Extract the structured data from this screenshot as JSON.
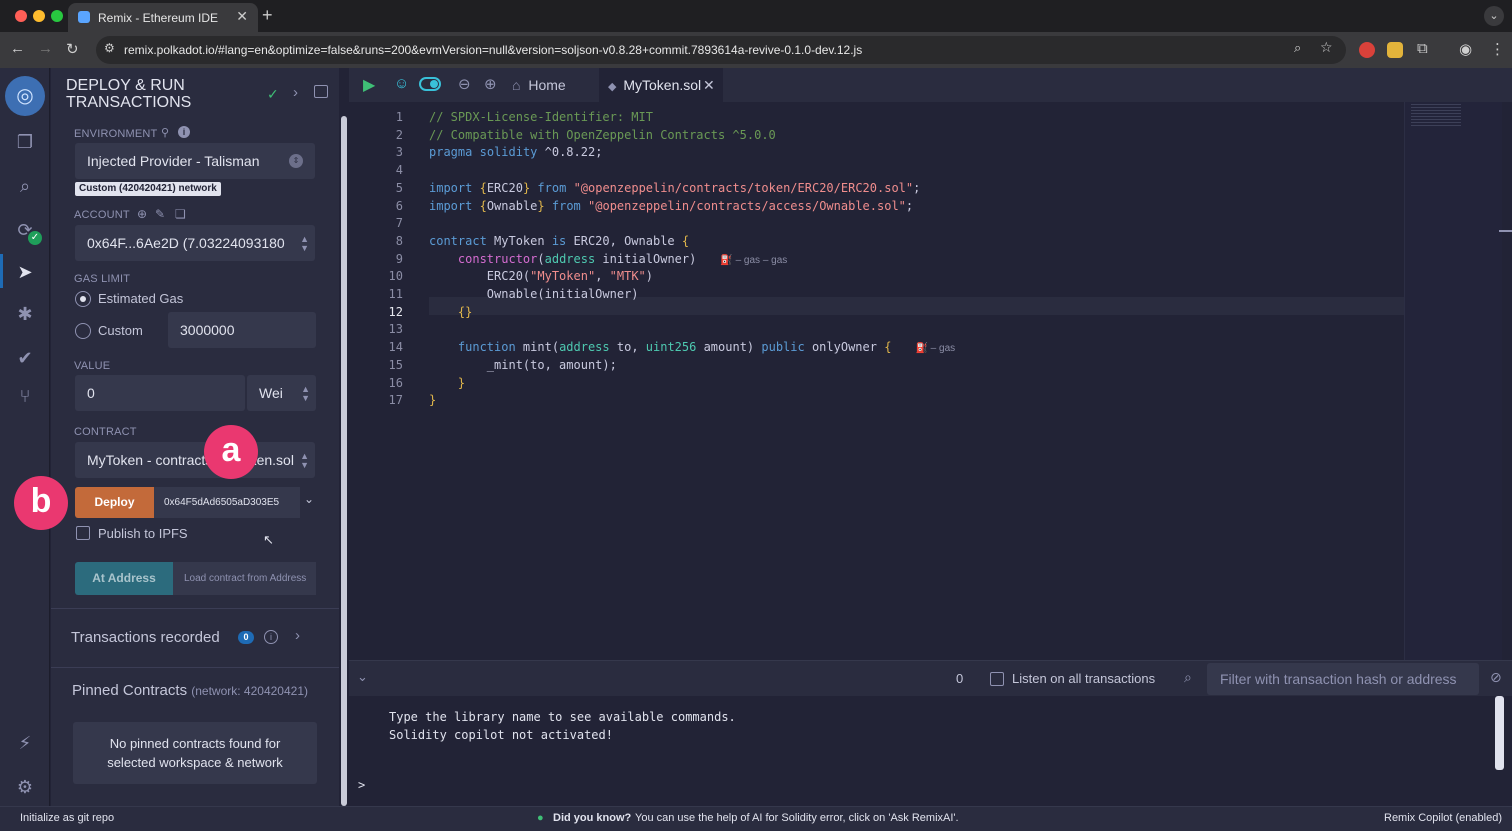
{
  "browser": {
    "tab_title": "Remix - Ethereum IDE",
    "url": "remix.polkadot.io/#lang=en&optimize=false&runs=200&evmVersion=null&version=soljson-v0.8.28+commit.7893614a-revive-0.1.0-dev.12.js"
  },
  "sidepanel": {
    "title_line1": "DEPLOY & RUN",
    "title_line2": "TRANSACTIONS",
    "environment_label": "ENVIRONMENT",
    "environment_value": "Injected Provider - Talisman",
    "network_badge": "Custom (420420421) network",
    "account_label": "ACCOUNT",
    "account_value": "0x64F...6Ae2D (7.03224093180",
    "gas_limit_label": "GAS LIMIT",
    "gas_estimated": "Estimated Gas",
    "gas_custom": "Custom",
    "gas_custom_value": "3000000",
    "value_label": "VALUE",
    "value_amount": "0",
    "value_unit": "Wei",
    "contract_label": "CONTRACT",
    "contract_value": "MyToken - contracts/MyToken.sol",
    "deploy_label": "Deploy",
    "deploy_arg": "0x64F5dAd6505aD303E5",
    "publish_ipfs": "Publish to IPFS",
    "at_address_label": "At Address",
    "at_address_placeholder": "Load contract from Address",
    "tx_recorded_label": "Transactions recorded",
    "tx_recorded_count": "0",
    "pinned_title": "Pinned Contracts",
    "pinned_network": "(network: 420420421)",
    "pinned_empty_line1": "No pinned contracts found for",
    "pinned_empty_line2": "selected workspace & network"
  },
  "annotations": {
    "a": "a",
    "b": "b"
  },
  "editor": {
    "tabs": [
      {
        "label": "Home"
      },
      {
        "label": "MyToken.sol"
      }
    ],
    "current_line": 12,
    "line_numbers": [
      "1",
      "2",
      "3",
      "4",
      "5",
      "6",
      "7",
      "8",
      "9",
      "10",
      "11",
      "12",
      "13",
      "14",
      "15",
      "16",
      "17"
    ],
    "lines": [
      "// SPDX-License-Identifier: MIT",
      "// Compatible with OpenZeppelin Contracts ^5.0.0",
      "pragma solidity ^0.8.22;",
      "",
      "import {ERC20} from \"@openzeppelin/contracts/token/ERC20/ERC20.sol\";",
      "import {Ownable} from \"@openzeppelin/contracts/access/Ownable.sol\";",
      "",
      "contract MyToken is ERC20, Ownable {",
      "    constructor(address initialOwner)",
      "        ERC20(\"MyToken\", \"MTK\")",
      "        Ownable(initialOwner)",
      "    {}",
      "",
      "    function mint(address to, uint256 amount) public onlyOwner {",
      "        _mint(to, amount);",
      "    }",
      "}"
    ],
    "gas_hint_constructor": "⛽ – gas – gas",
    "gas_hint_mint": "⛽ – gas"
  },
  "terminal": {
    "count": "0",
    "listen_label": "Listen on all transactions",
    "filter_placeholder": "Filter with transaction hash or address",
    "output_line1": "Type the library name to see available commands.",
    "output_line2": "Solidity copilot not activated!",
    "prompt": ">"
  },
  "statusbar": {
    "left": "Initialize as git repo",
    "tip_bold": "Did you know?",
    "tip_text": "You can use the help of AI for Solidity error, click on 'Ask RemixAI'.",
    "right": "Remix Copilot (enabled)"
  },
  "colors": {
    "deploy_orange": "#c36a3a",
    "at_address_teal": "#2c6b7d",
    "annotation_pink": "#ea3870",
    "accent_blue": "#1e6bb5"
  }
}
